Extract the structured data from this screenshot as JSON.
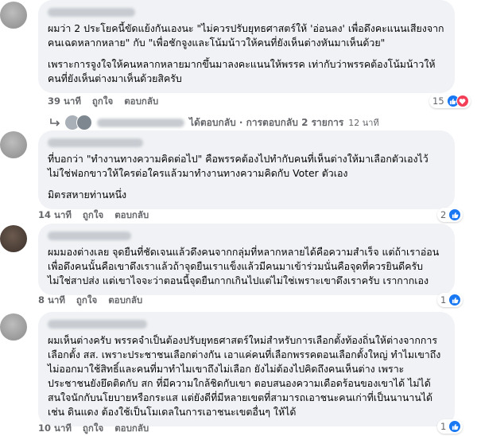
{
  "comments": [
    {
      "paragraphs": [
        "ผมว่า 2 ประโยคนี้ขัดแย้งกันเองนะ \"ไม่ควรปรับยุทธศาสตร์ให้ 'อ่อนลง' เพื่อดึงคะแนนเสียงจากคนเฉดหลากหลาย\" กับ \"เพื่อชักจูงและโน้มน้าวให้คนที่ยังเห็นต่างหันมาเห็นด้วย\"",
        "เพราะการจูงใจให้คนหลากหลายมากขึ้นมาลงคะแนนให้พรรค เท่ากับว่าพรรคต้องโน้มน้าวให้คนที่ยังเห็นต่างมาเห็นด้วยสิครับ"
      ],
      "time": "39 นาที",
      "like": "ถูกใจ",
      "reply": "ตอบกลับ",
      "reactions": "15",
      "replies_text": "ได้ตอบกลับ · การตอบกลับ 2 รายการ",
      "replies_time": "12 นาที"
    },
    {
      "paragraphs": [
        "ที่บอกว่า \"ทำงานทางความคิดต่อไป\" คือพรรคต้องไปทำกับคนที่เห็นต่างให้มาเลือกตัวเองไว้ไม่ใช่ฟอกขาวให้ใครต่อใครแล้วมาทำงานทางความคิดกับ Voter ตัวเอง",
        "มิตรสหายท่านหนึ่ง"
      ],
      "time": "14 นาที",
      "like": "ถูกใจ",
      "reply": "ตอบกลับ",
      "reactions": "2"
    },
    {
      "paragraphs": [
        "ผมมองต่างเลย จุดยืนที่ชัดเจนแล้วดึงคนจากกลุ่มที่หลากหลายได้คือความสำเร็จ แต่ถ้าเราอ่อนเพื่อดึงคนนั้นคือเขาดึงเราแล้วถ้าจุดยืนเราแข็งแล้วมีคนมาเข้าร่วมนั่นคือจุดที่ควรยินดีครับไม่ใช่สาปส่ง แต่เขาไจจะว่าตอนนี้จุดยืนกากเกินไปแต่ไม่ใช่เพราะเขาดึงเราครับ เรากากเอง"
      ],
      "time": "8 นาที",
      "like": "ถูกใจ",
      "reply": "ตอบกลับ",
      "reactions": "1"
    },
    {
      "paragraphs": [
        "ผมเห็นต่างครับ พรรคจำเป็นต้องปรับยุทธศาสตร์ใหม่สำหรับการเลือกตั้งท้องถิ่นให้ต่างจากการเลือกตั้ง สส. เพราะประชาชนเลือกต่างกัน เอาแค่คนที่เลือกพรรคตอนเลือกตั้งใหญ่ ทำไมเขาถึงไม่ออกมาใช้สิทธิ์และคนที่มาทำไมเขาถึงไม่เลือก ยังไม่ต้องไปคิดถึงคนเห็นต่าง เพราะประชาชนยังยึดติดกับ สก ที่มีความใกล้ชิดกับเขา ตอบสนองความเดือดร้อนของเขาได้ ไม่ได้สนใจนักกับนโยบายหรือกระแส แต่ยังดีที่มีหลายเขตที่สามารถเอาชนะคนเก่าที่เป็นนานานได้ เช่น ดินแดง ต้องใช้เป็นโมเดลในการเอาชนะเขตอื่นๆ ให้ได้"
      ],
      "time": "10 นาที",
      "like": "ถูกใจ",
      "reply": "ตอบกลับ",
      "reactions": "1"
    }
  ],
  "icons": {
    "like": "like-thumb-icon",
    "love": "love-heart-icon",
    "reply_arrow": "reply-arrow-icon"
  },
  "colors": {
    "bubble": "#f0f2f5",
    "like_blue": "#1877f2",
    "love_red": "#f33e58",
    "meta_gray": "#65676b"
  }
}
